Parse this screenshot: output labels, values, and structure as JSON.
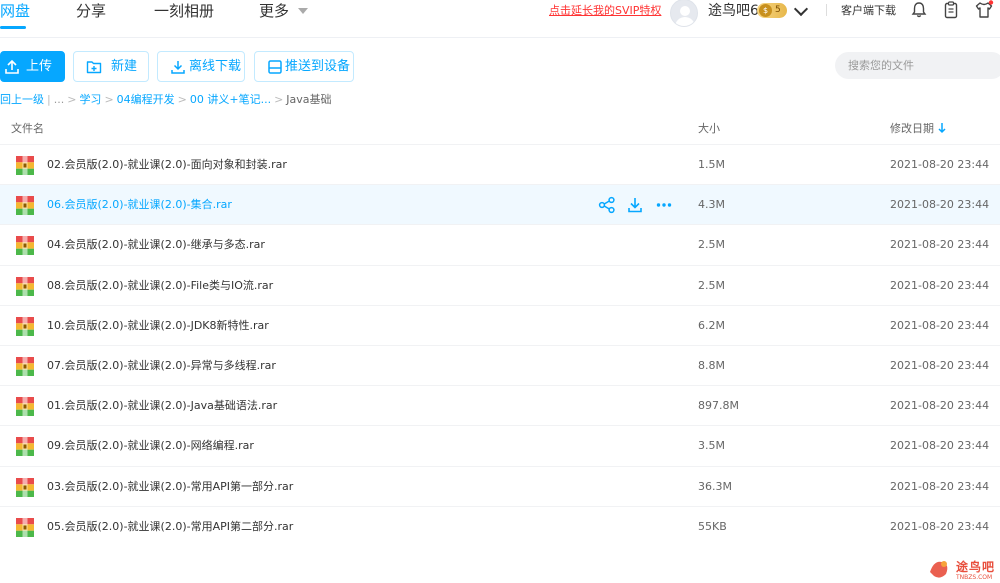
{
  "nav": {
    "tabs": [
      "网盘",
      "分享",
      "一刻相册",
      "更多"
    ],
    "promo": "点击延长我的SVIP特权",
    "username": "途鸟吧6",
    "vip_level": "5",
    "vip_coin": "$",
    "client_download": "客户端下载"
  },
  "toolbar": {
    "upload": "上传",
    "new": "新建",
    "offline_download": "离线下载",
    "push_to_device": "推送到设备",
    "search_placeholder": "搜索您的文件"
  },
  "breadcrumb": [
    "回上一级",
    "...",
    "学习",
    "04编程开发",
    "00 讲义+笔记...",
    "Java基础"
  ],
  "table": {
    "columns": [
      "文件名",
      "大小",
      "修改日期"
    ],
    "rows": [
      {
        "name": "02.会员版(2.0)-就业课(2.0)-面向对象和封装.rar",
        "size": "1.5M",
        "date": "2021-08-20 23:44"
      },
      {
        "name": "06.会员版(2.0)-就业课(2.0)-集合.rar",
        "size": "4.3M",
        "date": "2021-08-20 23:44"
      },
      {
        "name": "04.会员版(2.0)-就业课(2.0)-继承与多态.rar",
        "size": "2.5M",
        "date": "2021-08-20 23:44"
      },
      {
        "name": "08.会员版(2.0)-就业课(2.0)-File类与IO流.rar",
        "size": "2.5M",
        "date": "2021-08-20 23:44"
      },
      {
        "name": "10.会员版(2.0)-就业课(2.0)-JDK8新特性.rar",
        "size": "6.2M",
        "date": "2021-08-20 23:44"
      },
      {
        "name": "07.会员版(2.0)-就业课(2.0)-异常与多线程.rar",
        "size": "8.8M",
        "date": "2021-08-20 23:44"
      },
      {
        "name": "01.会员版(2.0)-就业课(2.0)-Java基础语法.rar",
        "size": "897.8M",
        "date": "2021-08-20 23:44"
      },
      {
        "name": "09.会员版(2.0)-就业课(2.0)-网络编程.rar",
        "size": "3.5M",
        "date": "2021-08-20 23:44"
      },
      {
        "name": "03.会员版(2.0)-就业课(2.0)-常用API第一部分.rar",
        "size": "36.3M",
        "date": "2021-08-20 23:44"
      },
      {
        "name": "05.会员版(2.0)-就业课(2.0)-常用API第二部分.rar",
        "size": "55KB",
        "date": "2021-08-20 23:44"
      }
    ]
  },
  "watermark": {
    "text": "途鸟吧",
    "sub": "TNBZS.COM"
  },
  "colors": {
    "accent": "#06a7ff",
    "promo": "#ff3333",
    "row_hover": "#f0f9ff"
  }
}
